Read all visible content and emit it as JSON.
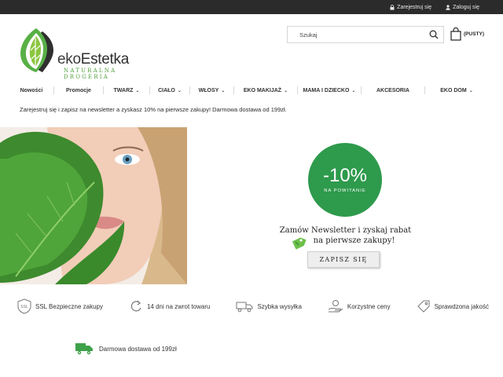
{
  "topbar": {
    "register_label": "Zarejestruj się",
    "login_label": "Zaloguj się"
  },
  "logo": {
    "brand_prefix": "eko",
    "brand_suffix": "Estetka",
    "tagline": "NATURALNA DROGERIA"
  },
  "search": {
    "placeholder": "Szukaj"
  },
  "cart": {
    "label": "(PUSTY)"
  },
  "nav": {
    "items": [
      {
        "label": "Nowości",
        "dropdown": false
      },
      {
        "label": "Promocje",
        "dropdown": false
      },
      {
        "label": "TWARZ",
        "dropdown": true
      },
      {
        "label": "CIAŁO",
        "dropdown": true
      },
      {
        "label": "WŁOSY",
        "dropdown": true
      },
      {
        "label": "EKO MAKIJAŻ",
        "dropdown": true
      },
      {
        "label": "MAMA I DZIECKO",
        "dropdown": true
      },
      {
        "label": "AKCESORIA",
        "dropdown": false
      },
      {
        "label": "EKO DOM",
        "dropdown": true
      }
    ]
  },
  "promo_text": "Zarejestruj się i zapisz na newsletter a zyskasz 10% na pierwsze zakupy! Darmowa dostawa od 199zł.",
  "hero": {
    "badge_percent": "-10%",
    "badge_sub": "NA POWITANIE",
    "headline_line1": "Zamów Newsletter i zyskaj rabat",
    "headline_line2": "na pierwsze zakupy!",
    "cta_label": "ZAPISZ SIĘ"
  },
  "features": [
    {
      "icon": "ssl-shield-icon",
      "label": "SSL Bezpieczne zakupy"
    },
    {
      "icon": "return-arrow-icon",
      "label": "14 dni na zwrot towaru"
    },
    {
      "icon": "delivery-truck-icon",
      "label": "Szybka wysyłka"
    },
    {
      "icon": "price-hand-icon",
      "label": "Korzystne ceny"
    },
    {
      "icon": "quality-tag-icon",
      "label": "Sprawdzona jakość"
    }
  ],
  "delivery_text": "Darmowa dostawa od 199zł",
  "colors": {
    "topbar": "#2b2b2b",
    "accent_green": "#2e9a4c",
    "logo_green": "#4fa03a"
  }
}
